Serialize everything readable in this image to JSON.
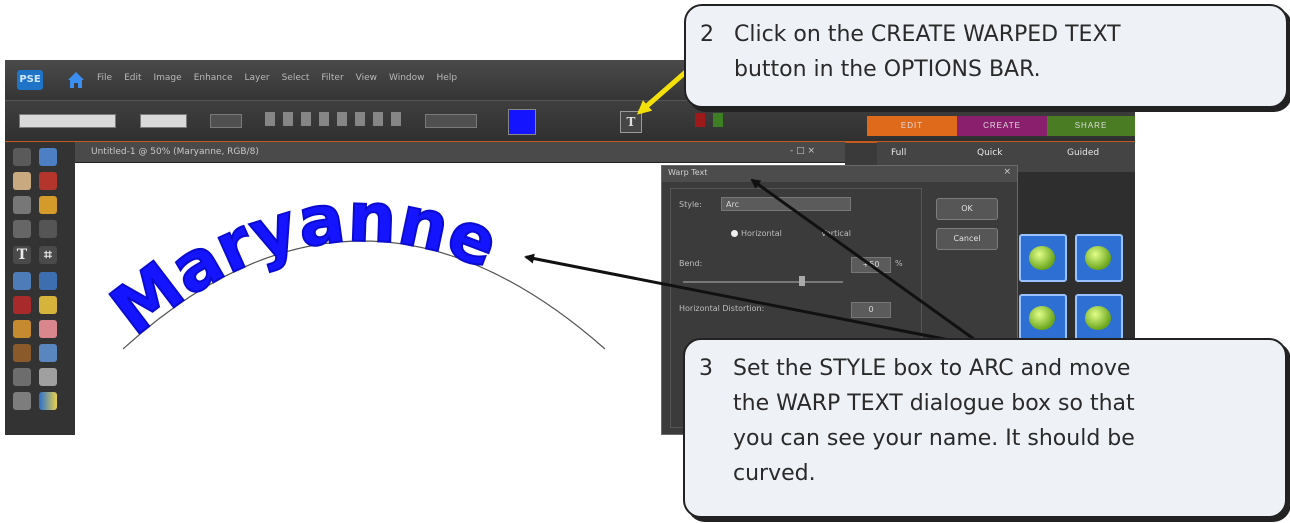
{
  "app": {
    "logo_text": "PSE",
    "menu": [
      "File",
      "Edit",
      "Image",
      "Enhance",
      "Layer",
      "Select",
      "Filter",
      "View",
      "Window",
      "Help"
    ],
    "tool_icons": [
      "move-icon",
      "zoom-icon",
      "hand-icon",
      "eyedropper-icon",
      "lasso-icon",
      "magic-wand-icon",
      "quick-selection-icon",
      "type-icon",
      "crop-icon",
      "cookie-cutter-icon",
      "red-eye-icon",
      "healing-brush-icon",
      "brush-icon",
      "eraser-icon",
      "paint-bucket-icon",
      "gradient-icon",
      "shape-icon"
    ]
  },
  "options_bar": {
    "warp_button_label": "T",
    "text_color": "#1414ff"
  },
  "mode_tabs": [
    {
      "label": "EDIT",
      "color": "#e06a1c"
    },
    {
      "label": "CREATE",
      "color": "#8a1f6e"
    },
    {
      "label": "SHARE",
      "color": "#4a7d23"
    }
  ],
  "document": {
    "title": "Untitled-1 @ 50% (Maryanne, RGB/8)",
    "controls": "- □ ×",
    "text": "Maryanne"
  },
  "panel": {
    "tabs": [
      "Full",
      "Quick",
      "Guided"
    ]
  },
  "warp_dialog": {
    "title": "Warp Text",
    "close": "×",
    "style_label": "Style:",
    "style_value": "Arc",
    "orientation_horizontal": "Horizontal",
    "orientation_vertical": "Vertical",
    "bend_label": "Bend:",
    "bend_value": "+50",
    "bend_unit": "%",
    "bend_level": 0.75,
    "hdistortion_label": "Horizontal Distortion:",
    "hdistortion_value": "0",
    "ok_label": "OK",
    "cancel_label": "Cancel"
  },
  "callouts": {
    "step2": {
      "number": "2",
      "lines": [
        "Click on the CREATE WARPED TEXT",
        "button in the OPTIONS BAR."
      ]
    },
    "step3": {
      "number": "3",
      "lines": [
        "Set the STYLE box to ARC and move",
        "the WARP TEXT dialogue box so that",
        "you can see your name.  It should be",
        "curved."
      ]
    }
  }
}
